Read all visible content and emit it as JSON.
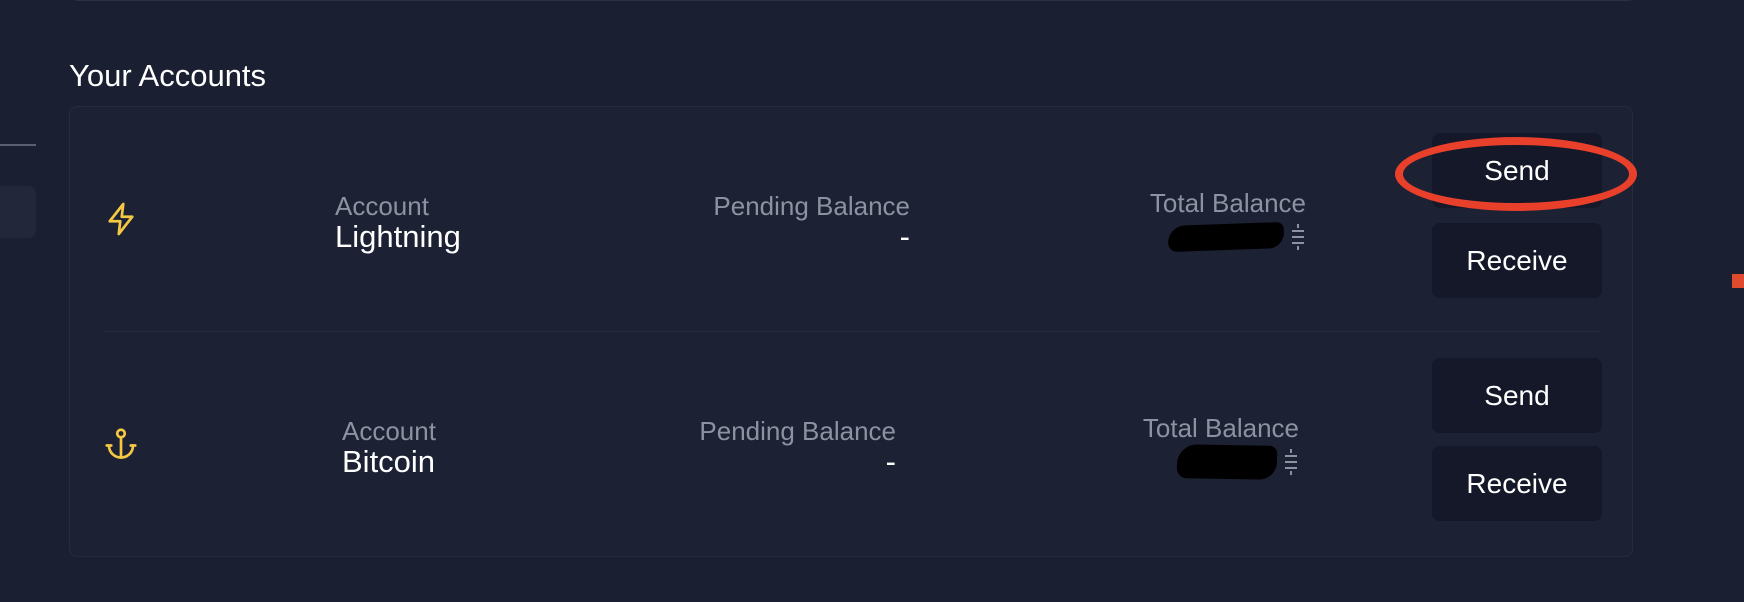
{
  "section": {
    "title": "Your Accounts"
  },
  "accounts": [
    {
      "icon": "lightning-icon",
      "account_label": "Account",
      "account_name": "Lightning",
      "pending_label": "Pending Balance",
      "pending_value": "-",
      "total_label": "Total Balance",
      "total_value_redacted": true,
      "unit_icon": "satoshi-icon",
      "send_label": "Send",
      "receive_label": "Receive"
    },
    {
      "icon": "anchor-icon",
      "account_label": "Account",
      "account_name": "Bitcoin",
      "pending_label": "Pending Balance",
      "pending_value": "-",
      "total_label": "Total Balance",
      "total_value_redacted": true,
      "unit_icon": "satoshi-icon",
      "send_label": "Send",
      "receive_label": "Receive"
    }
  ],
  "colors": {
    "background": "#1a1f32",
    "card": "#1c2134",
    "button": "#141828",
    "accent_icon": "#f4c842",
    "label_gray": "#8d91a0",
    "annotation_red": "#e8402a"
  }
}
